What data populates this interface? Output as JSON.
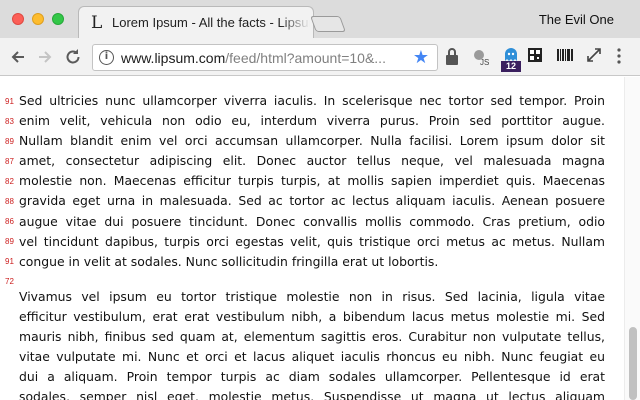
{
  "window": {
    "tab_title": "Lorem Ipsum - All the facts - Lipsum generator",
    "tab_favicon": "L",
    "profile_name": "The Evil One"
  },
  "toolbar": {
    "url_host": "www.lipsum.com",
    "url_path": "/feed/html?amount=10&...",
    "extension_badge": "12",
    "info_glyph": "i"
  },
  "icons": [
    "back-arrow-icon",
    "forward-arrow-icon",
    "reload-icon",
    "info-icon",
    "bookmark-star-icon",
    "lock-icon",
    "javascript-icon",
    "ghost-icon",
    "qr-code-icon",
    "barcode-icon",
    "resize-icon",
    "menu-icon"
  ],
  "colors": {
    "accent": "#4486f4",
    "line_numbers": "#cc2020",
    "badge": "#3a1f5e"
  },
  "content": {
    "line_numbers": [
      "91",
      "83",
      "89",
      "87",
      "82",
      "88",
      "86",
      "89",
      "91",
      "72"
    ],
    "paragraph1_lines": [
      "Sed ultricies nunc ullamcorper viverra iaculis. In scelerisque nec tortor sed tempor. Proin",
      "enim velit, vehicula non odio eu, interdum viverra purus. Proin sed porttitor augue.",
      "Nullam blandit enim vel orci accumsan ullamcorper. Nulla facilisi. Lorem ipsum dolor sit",
      "amet, consectetur adipiscing elit. Donec auctor tellus neque, vel malesuada magna",
      "molestie non. Maecenas efficitur turpis turpis, at mollis sapien imperdiet quis. Maecenas",
      "gravida eget urna in malesuada. Sed ac tortor ac lectus aliquam iaculis. Aenean posuere",
      "augue vitae dui posuere tincidunt. Donec convallis mollis commodo. Cras pretium, odio",
      "vel tincidunt dapibus, turpis orci egestas velit, quis tristique orci metus ac metus. Nullam",
      "congue in velit at sodales. Nunc sollicitudin fringilla erat ut lobortis."
    ],
    "paragraph2_lines": [
      "Vivamus vel ipsum eu tortor tristique molestie non in risus. Sed lacinia, ligula vitae",
      "efficitur vestibulum, erat erat vestibulum nibh, a bibendum lacus metus molestie mi. Sed",
      "mauris nibh, finibus sed quam at, elementum sagittis eros. Curabitur non vulputate tellus,",
      "vitae vulputate mi. Nunc et orci et lacus aliquet iaculis rhoncus eu nibh. Nunc feugiat eu",
      "dui a aliquam. Proin tempor turpis ac diam sodales ullamcorper. Pellentesque id erat",
      "sodales, semper nisl eget, molestie metus. Suspendisse ut magna ut lectus aliquam"
    ]
  }
}
